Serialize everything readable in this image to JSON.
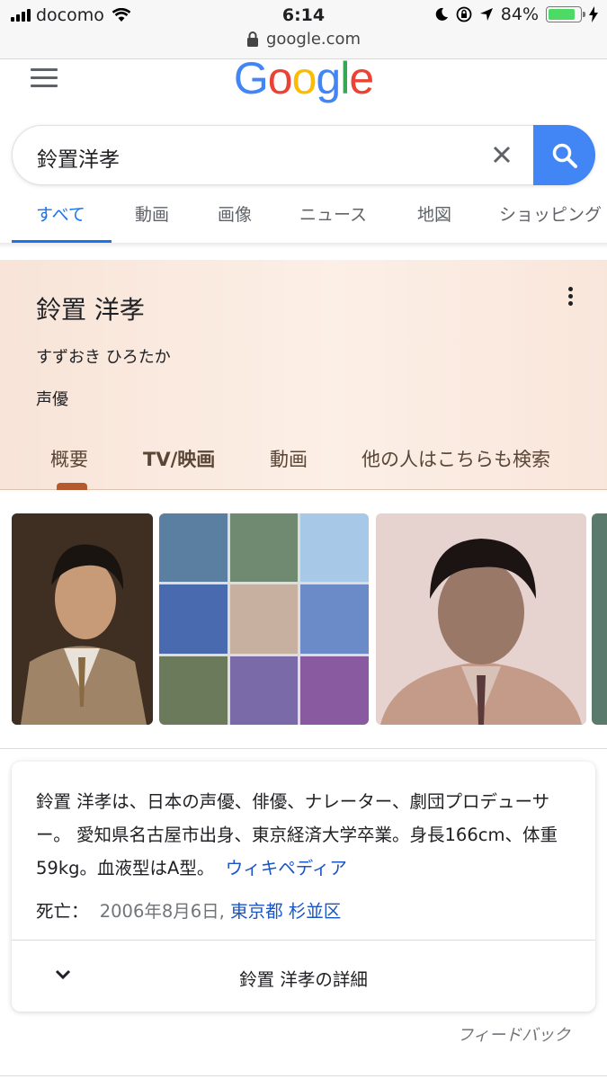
{
  "status_bar": {
    "carrier": "docomo",
    "time": "6:14",
    "battery": "84%"
  },
  "url_bar": {
    "domain": "google.com"
  },
  "header": {
    "logo_letters": [
      "G",
      "o",
      "o",
      "g",
      "l",
      "e"
    ]
  },
  "search": {
    "query": "鈴置洋孝"
  },
  "tabs": [
    {
      "label": "すべて"
    },
    {
      "label": "動画"
    },
    {
      "label": "画像"
    },
    {
      "label": "ニュース"
    },
    {
      "label": "地図"
    },
    {
      "label": "ショッピング"
    }
  ],
  "knowledge_panel": {
    "title": "鈴置 洋孝",
    "reading": "すずおき ひろたか",
    "type": "声優",
    "tabs": [
      {
        "label": "概要"
      },
      {
        "label": "TV/映画"
      },
      {
        "label": "動画"
      },
      {
        "label": "他の人はこちらも検索"
      }
    ]
  },
  "description": {
    "text": "鈴置 洋孝は、日本の声優、俳優、ナレーター、劇団プロデューサー。 愛知県名古屋市出身、東京経済大学卒業。身長166cm、体重59kg。血液型はA型。",
    "source_link": "ウィキペディア",
    "death_label": "死亡：",
    "death_date": "2006年8月6日,",
    "death_place_1": "東京都",
    "death_place_2": "杉並区",
    "details_label": "鈴置 洋孝の詳細"
  },
  "feedback": "フィードバック"
}
